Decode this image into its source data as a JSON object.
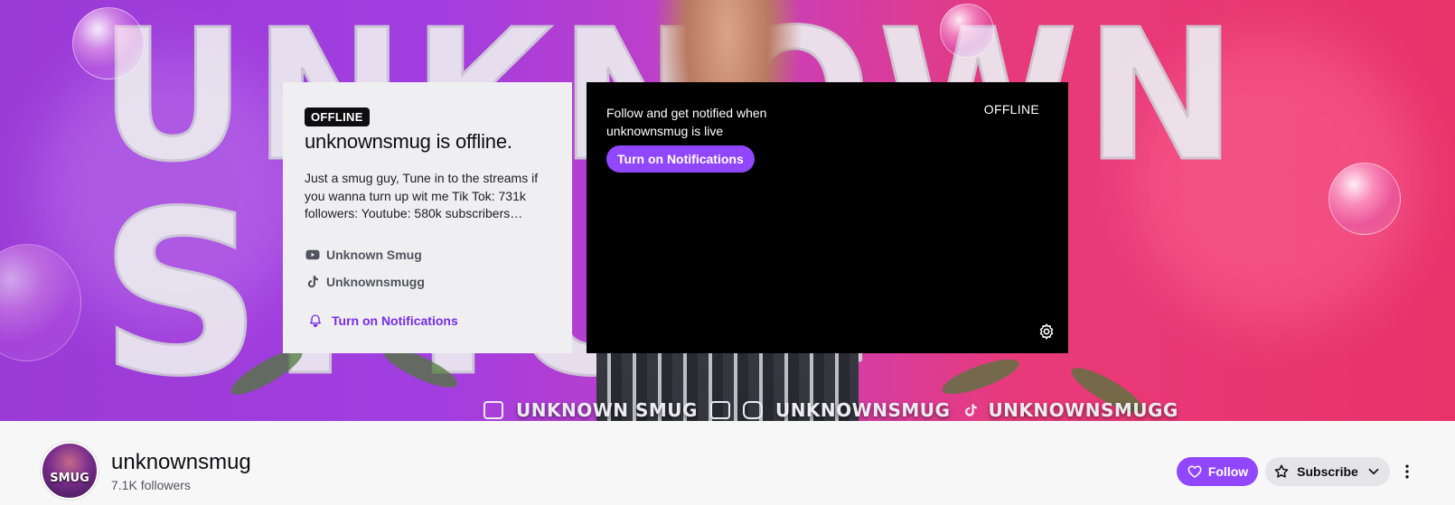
{
  "banner": {
    "big_text_top": "UNKNOWN",
    "big_text_bottom": "SMUG",
    "social_strip": [
      "UNKNOWN SMUG",
      "UNKNOWNSMUG",
      "UNKNOWNSMUGG"
    ]
  },
  "info_card": {
    "badge": "OFFLINE",
    "title": "unknownsmug is offline.",
    "description": "Just a smug guy, Tune in to the streams if you wanna turn up wit me Tik Tok: 731k followers: Youtube: 580k subscribers…",
    "socials": [
      {
        "icon": "youtube-icon",
        "label": "Unknown Smug"
      },
      {
        "icon": "tiktok-icon",
        "label": "Unknownsmugg"
      }
    ],
    "notifications_link": "Turn on Notifications"
  },
  "player": {
    "message": "Follow and get notified when unknownsmug is live",
    "status": "OFFLINE",
    "button": "Turn on Notifications"
  },
  "channel": {
    "avatar_text": "SMUG",
    "name": "unknownsmug",
    "followers": "7.1K followers",
    "follow_label": "Follow",
    "subscribe_label": "Subscribe"
  },
  "colors": {
    "accent": "#9147ff",
    "link": "#772ce8",
    "banner_left": "#a23ee0",
    "banner_right": "#e8336a"
  }
}
